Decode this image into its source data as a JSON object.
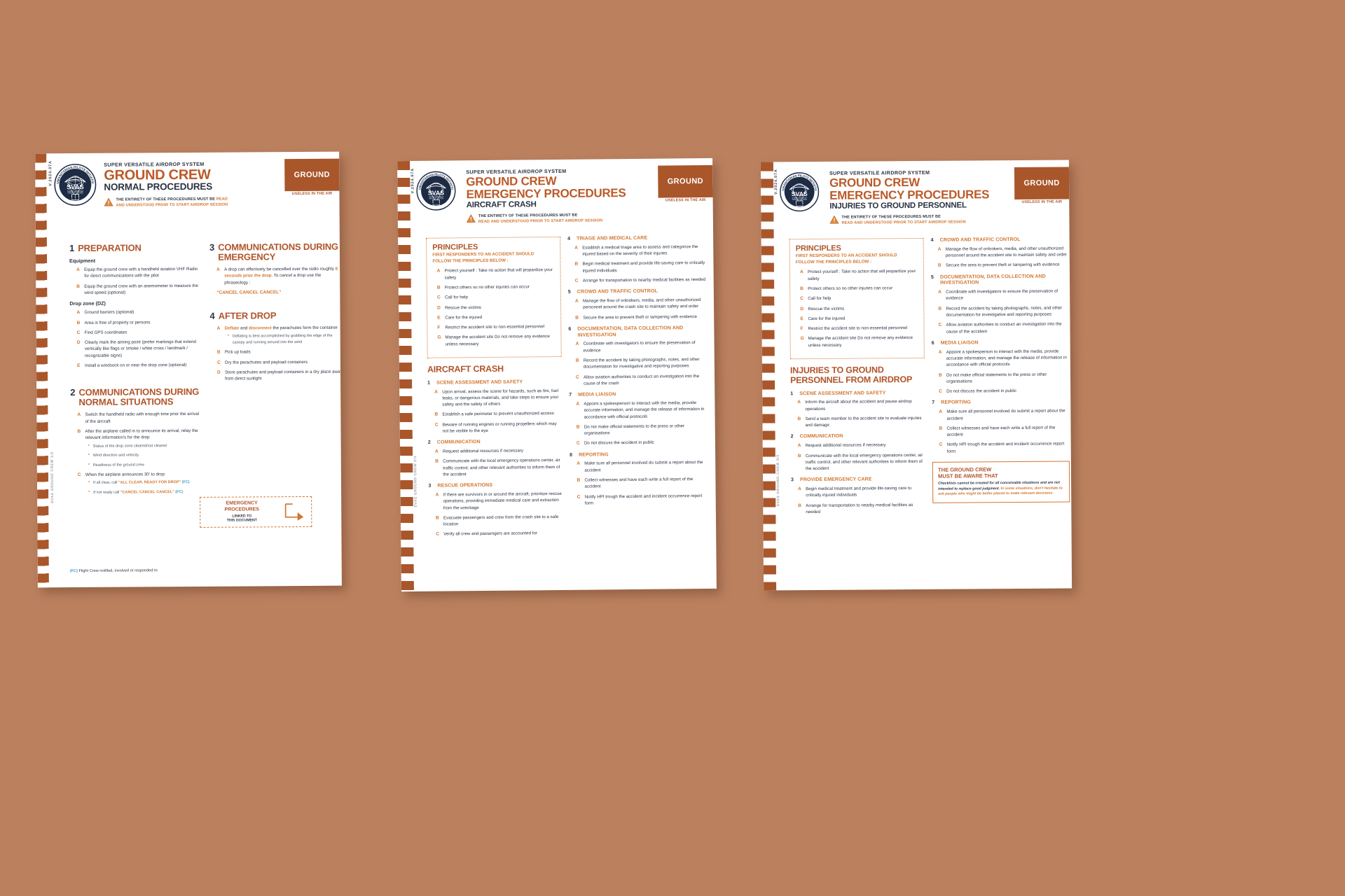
{
  "background_color": "#bb815f",
  "accent_orange": "#d2762f",
  "accent_rust": "#b0552a",
  "accent_navy": "#2b3443",
  "accent_blue": "#3ea0c9",
  "common": {
    "system_line": "SUPER VERSATILE AIRDROP SYSTEM",
    "brand_main": "GROUND CREW",
    "version_code": "V.2024.07A",
    "badge_label": "GROUND",
    "badge_sublabel": "USELESS IN THE AIR",
    "warning_line1_plain": "THE ENTIRETY OF THESE PROCEDURES MUST BE ",
    "warning_line1_accent": "READ",
    "warning_line2": "AND UNDERSTOOD PRIOR TO START AIRDROP SESSION",
    "warning_alt_line1": "THE ENTIRETY OF THESE PROCEDURES MUST BE",
    "warning_alt_line2": "READ AND UNDERSTOOD PRIOR TO START AIRDROP SESSION",
    "logo_ring_text": "HUMANITARIAN PILOTS INITIATIVE",
    "logo_center": "SVAS",
    "logo_center_sub1": "SUPER VERSATILE",
    "logo_center_sub2": "AIRDROP SYSTEM",
    "logo_bottom": "WWW.HPI.SWISS"
  },
  "page1": {
    "side_label": "SVAS GROUND CREW 1/3",
    "title_sub": "NORMAL PROCEDURES",
    "sections": [
      {
        "number": "1",
        "heading": "PREPARATION",
        "groups": [
          {
            "subhead": "Equipment",
            "items": [
              {
                "letter": "A",
                "text": "Equip the ground crew with a handheld aviation VHF Radio for direct communications with the pilot"
              },
              {
                "letter": "B",
                "text": "Equip the ground crew with an anemometer to measure the wind speed (optional)"
              }
            ]
          },
          {
            "subhead": "Drop zone (DZ)",
            "items": [
              {
                "letter": "A",
                "text": "Ground barriers (optional)"
              },
              {
                "letter": "B",
                "text": "Area is free of property or persons"
              },
              {
                "letter": "C",
                "text": "Find GPS coordinates"
              },
              {
                "letter": "D",
                "text": "Clearly mark the aiming point (prefer markings that extend vertically like flags or smoke / white cross / landmark / recognizable signs)"
              },
              {
                "letter": "E",
                "text": "Install a windsock on or near the drop zone (optional)"
              }
            ]
          }
        ]
      },
      {
        "number": "2",
        "heading": "COMMUNICATIONS DURING NORMAL SITUATIONS",
        "groups": [
          {
            "subhead": "",
            "items": [
              {
                "letter": "A",
                "text": "Switch the handheld radio with enough time prior the arrival of the aircraft"
              },
              {
                "letter": "B",
                "text": "After the airplane called in to announce its arrival, relay the relevant information's for the drop",
                "sub": [
                  "Status of the drop zone cleared/not cleared",
                  "Wind direction and velocity",
                  "Readiness of the ground crew"
                ]
              },
              {
                "letter": "C",
                "text": "When the airplane announces 30' to drop",
                "sub_rich": [
                  {
                    "pre": "If all clear, call ",
                    "quote": "\"ALL CLEAR, READY FOR DROP\"",
                    "tag": "(FC)"
                  },
                  {
                    "pre": "If not ready call ",
                    "quote": "\"CANCEL CANCEL CANCEL\"",
                    "tag": "(FC)"
                  }
                ]
              }
            ]
          }
        ]
      },
      {
        "number": "3",
        "heading": "COMMUNICATIONS DURING EMERGENCY",
        "groups": [
          {
            "subhead": "",
            "items": [
              {
                "letter": "A",
                "text_rich": [
                  {
                    "t": "A drop can effectively be cancelled "
                  },
                  {
                    "t": "over the radio roughly "
                  },
                  {
                    "t": "8 seconds prior the drop",
                    "style": "or"
                  },
                  {
                    "t": ". To cancel a drop use the phraseology :"
                  }
                ]
              }
            ],
            "quote": "\"CANCEL CANCEL CANCEL\""
          }
        ]
      },
      {
        "number": "4",
        "heading": "AFTER DROP",
        "groups": [
          {
            "subhead": "",
            "items": [
              {
                "letter": "A",
                "text_rich": [
                  {
                    "t": "Deflate",
                    "style": "or"
                  },
                  {
                    "t": " and "
                  },
                  {
                    "t": "disconnect",
                    "style": "or"
                  },
                  {
                    "t": " the parachutes form the container"
                  }
                ],
                "sub": [
                  "Deflating is best accomplished by grabbing the edge of the canopy and running around into the wind"
                ]
              },
              {
                "letter": "B",
                "text": "Pick up loads"
              },
              {
                "letter": "C",
                "text": "Dry the parachutes and payload containers"
              },
              {
                "letter": "D",
                "text": "Store parachutes and payload containers in a dry place away from direct sunlight"
              }
            ]
          }
        ]
      }
    ],
    "emergency_link": {
      "line1": "EMERGENCY",
      "line2": "PROCEDURES",
      "sub1": "LINKED TO",
      "sub2": "THIS DOCUMENT"
    },
    "footnote_tag": "(FC)",
    "footnote_text": " Flight Crew notified, involved or responded to"
  },
  "page2": {
    "side_label": "SVAS GROUND CREW 2/3",
    "title_main": "GROUND CREW",
    "title_line2": "EMERGENCY PROCEDURES",
    "title_sub": "AIRCRAFT CRASH",
    "principles": {
      "title": "PRINCIPLES",
      "sub1": "FIRST RESPONDERS TO AN ACCIDENT SHOULD",
      "sub2": "FOLLOW THE PRINCIPLES BELOW :",
      "items": [
        {
          "letter": "A",
          "text": "Protect yourself : Take no action that will jeopardize your safety"
        },
        {
          "letter": "B",
          "text": "Protect others so no other injuries can occur"
        },
        {
          "letter": "C",
          "text": "Call for help"
        },
        {
          "letter": "D",
          "text": "Rescue the victims"
        },
        {
          "letter": "E",
          "text": "Care for the injured"
        },
        {
          "letter": "F",
          "text": "Restrict the accident site to non-essential personnel"
        },
        {
          "letter": "G",
          "text": "Manage the accident site Do not remove any evidence unless necessary"
        }
      ]
    },
    "big_heading": "AIRCRAFT CRASH",
    "left_sections": [
      {
        "number": "1",
        "heading": "SCENE ASSESSMENT AND SAFETY",
        "items": [
          {
            "letter": "A",
            "text": "Upon arrival, assess the scene for hazards, such as fire, fuel leaks, or dangerous materials, and take steps to ensure your safety and the safety of others"
          },
          {
            "letter": "B",
            "text": "Establish a safe perimeter to prevent unauthorized access"
          },
          {
            "letter": "C",
            "text": "Beware of running engines or running propellers which may not be visible to the eye"
          }
        ]
      },
      {
        "number": "2",
        "heading": "COMMUNICATION",
        "items": [
          {
            "letter": "A",
            "text": "Request additional resources if necessary"
          },
          {
            "letter": "B",
            "text": "Communicate with the local emergency operations center, air traffic control, and other relevant authorities to inform them of the accident"
          }
        ]
      },
      {
        "number": "3",
        "heading": "RESCUE OPERATIONS",
        "items": [
          {
            "letter": "A",
            "text": "If there are survivors in or around the aircraft, prioritize rescue operations, providing immediate medical care and extraction from the wreckage"
          },
          {
            "letter": "B",
            "text": "Evacuate passengers and crew from the crash site to a safe location"
          },
          {
            "letter": "C",
            "text": "Verify all crew and passengers are accounted for"
          }
        ]
      }
    ],
    "right_sections": [
      {
        "number": "4",
        "heading": "TRIAGE AND MEDICAL CARE",
        "items": [
          {
            "letter": "A",
            "text": "Establish a medical triage area to assess and categorize the injured based on the severity of their injuries"
          },
          {
            "letter": "B",
            "text": "Begin medical treatment and provide life-saving care to critically injured individuals"
          },
          {
            "letter": "C",
            "text": "Arrange for transportation to nearby medical facilities as needed"
          }
        ]
      },
      {
        "number": "5",
        "heading": "CROWD AND TRAFFIC CONTROL",
        "items": [
          {
            "letter": "A",
            "text": "Manage the flow of onlookers, media, and other unauthorized personnel around the crash site to maintain safety and order"
          },
          {
            "letter": "B",
            "text": "Secure the area to prevent theft or tampering with evidence"
          }
        ]
      },
      {
        "number": "6",
        "heading": "DOCUMENTATION, DATA COLLECTION AND INVESTIGATION",
        "items": [
          {
            "letter": "A",
            "text": "Coordinate with investigators to ensure the preservation of evidence"
          },
          {
            "letter": "B",
            "text": "Record the accident by taking photographs, notes, and other documentation for investigative and reporting purposes"
          },
          {
            "letter": "C",
            "text": "Allow aviation authorities to conduct an investigation into the cause of the crash"
          }
        ]
      },
      {
        "number": "7",
        "heading": "MEDIA LIAISON",
        "items": [
          {
            "letter": "A",
            "text": "Appoint a spokesperson to interact with the media, provide accurate information, and manage the release of information in accordance with official protocols"
          },
          {
            "letter": "B",
            "text": "Do not make official statements to the press or other organisations"
          },
          {
            "letter": "C",
            "text": "Do not discuss the accident in public"
          }
        ]
      },
      {
        "number": "8",
        "heading": "REPORTING",
        "items": [
          {
            "letter": "A",
            "text": "Make sure all personnel involved do submit a report about the accident"
          },
          {
            "letter": "B",
            "text": "Collect witnesses and have each write a full report of the accident"
          },
          {
            "letter": "C",
            "text": "Notify HPI trough the accident and incident occurrence report form"
          }
        ]
      }
    ]
  },
  "page3": {
    "side_label": "SVAS GROUND CREW 3/3",
    "title_main": "GROUND CREW",
    "title_line2": "EMERGENCY PROCEDURES",
    "title_sub": "INJURIES TO GROUND PERSONNEL",
    "principles": {
      "title": "PRINCIPLES",
      "sub1": "FIRST RESPONDERS TO AN ACCIDENT SHOULD",
      "sub2": "FOLLOW THE PRINCIPLES BELOW :",
      "items": [
        {
          "letter": "A",
          "text": "Protect yourself : Take no action that will jeopardize your safety"
        },
        {
          "letter": "B",
          "text": "Protect others so no other injuries can occur"
        },
        {
          "letter": "C",
          "text": "Call for help"
        },
        {
          "letter": "D",
          "text": "Rescue the victims"
        },
        {
          "letter": "E",
          "text": "Care for the injured"
        },
        {
          "letter": "F",
          "text": "Restrict the accident site to non-essential personnel"
        },
        {
          "letter": "G",
          "text": "Manage the accident site Do not remove any evidence unless necessary"
        }
      ]
    },
    "big_heading_line1": "INJURIES TO GROUND",
    "big_heading_line2": "PERSONNEL FROM AIRDROP",
    "left_sections": [
      {
        "number": "1",
        "heading": "SCENE ASSESSMENT AND SAFETY",
        "items": [
          {
            "letter": "A",
            "text": "Inform the aircraft about the accident and pause airdrop operations"
          },
          {
            "letter": "B",
            "text": "Send a team member to the accident site to evaluate injuries and damage"
          }
        ]
      },
      {
        "number": "2",
        "heading": "COMMUNICATION",
        "items": [
          {
            "letter": "A",
            "text": "Request additional resources if necessary"
          },
          {
            "letter": "B",
            "text": "Communicate with the local emergency operations center, air traffic control, and other relevant authorities to inform them of the accident"
          }
        ]
      },
      {
        "number": "3",
        "heading": "PROVIDE EMERGENCY CARE",
        "items": [
          {
            "letter": "A",
            "text": "Begin medical treatment and provide life-saving care to critically injured individuals"
          },
          {
            "letter": "B",
            "text": "Arrange for transportation to nearby medical facilities as needed"
          }
        ]
      }
    ],
    "right_sections": [
      {
        "number": "4",
        "heading": "CROWD AND TRAFFIC CONTROL",
        "items": [
          {
            "letter": "A",
            "text": "Manage the flow of onlookers, media, and other unauthorized personnel around the accident site to maintain safety and order"
          },
          {
            "letter": "B",
            "text": "Secure the area to prevent theft or tampering with evidence"
          }
        ]
      },
      {
        "number": "5",
        "heading": "DOCUMENTATION, DATA COLLECTION AND INVESTIGATION",
        "items": [
          {
            "letter": "A",
            "text": "Coordinate with investigators to ensure the preservation of evidence"
          },
          {
            "letter": "B",
            "text": "Record the accident by taking photographs, notes, and other documentation for investigative and reporting purposes"
          },
          {
            "letter": "C",
            "text": "Allow aviation authorities to conduct an investigation into the cause of the accident"
          }
        ]
      },
      {
        "number": "6",
        "heading": "MEDIA LIAISON",
        "items": [
          {
            "letter": "A",
            "text": "Appoint a spokesperson to interact with the media, provide accurate information, and manage the release of information in accordance with official protocols"
          },
          {
            "letter": "B",
            "text": "Do not make official statements to the press or other organisations"
          },
          {
            "letter": "C",
            "text": "Do not discuss the accident in public"
          }
        ]
      },
      {
        "number": "7",
        "heading": "REPORTING",
        "items": [
          {
            "letter": "A",
            "text": "Make sure all personnel involved do submit a report about the accident"
          },
          {
            "letter": "B",
            "text": "Collect witnesses and have each write a full report of the accident"
          },
          {
            "letter": "C",
            "text": "Notify HPI trough the accident and incident occurrence report form"
          }
        ]
      }
    ],
    "aware_box": {
      "heading_line1": "THE GROUND CREW",
      "heading_line2": "MUST BE AWARE THAT",
      "body_dark": "Checklists cannot be created for all conceivable situations and are not intended to replace good judgment.",
      "body_orange": "In some situations, don't hesitate to ask people who might be better placed to make relevant decisions."
    }
  }
}
